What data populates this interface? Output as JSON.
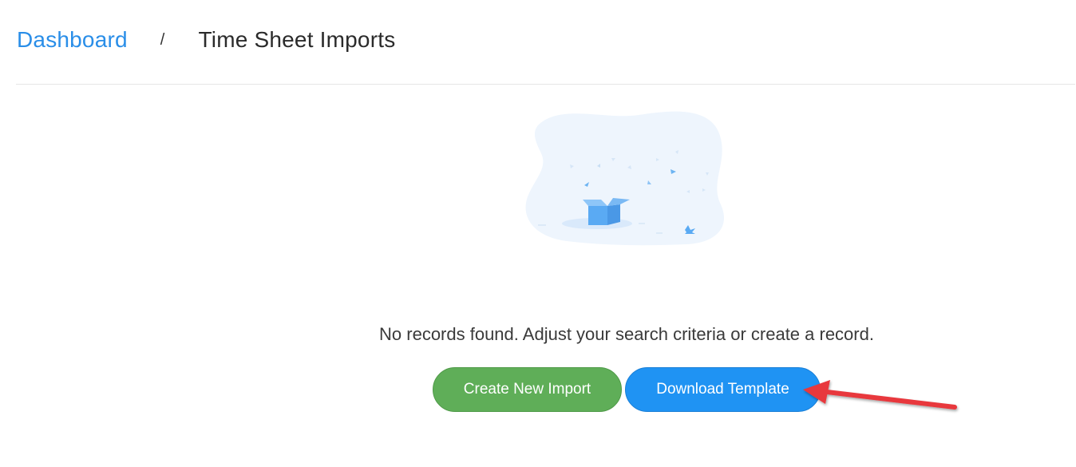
{
  "breadcrumb": {
    "home_label": "Dashboard",
    "separator": "/",
    "current_label": "Time Sheet Imports"
  },
  "empty_state": {
    "illustration_icon": "empty-box-icon",
    "message": "No records found. Adjust your search criteria or create a record."
  },
  "actions": {
    "create_label": "Create New Import",
    "download_label": "Download Template"
  },
  "colors": {
    "link": "#2a8ee8",
    "primary_green": "#5fae58",
    "primary_blue": "#1f93f3",
    "annotation_arrow": "#e8393d"
  }
}
